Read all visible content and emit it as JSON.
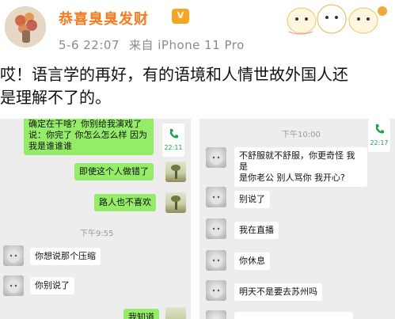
{
  "header": {
    "username": "恭喜臭臭发财",
    "vip_badge": "V",
    "date": "5-6 22:07",
    "source": "来自 iPhone 11 Pro"
  },
  "post": {
    "line1": "哎！语言学的再好，有的语境和人情世故外国人还",
    "line2": "是理解不了的。"
  },
  "left_chat": {
    "top_bubble": [
      "确定在干啥？你别给我演戏了",
      "说：你完了 你怎么怎么样 因为",
      "我是谁谁谁"
    ],
    "call_time": "22:11",
    "msg1": "即使这个人做错了",
    "msg2": "路人也不喜欢",
    "timestamp": "下午9:55",
    "msg3": "你想说那个压缩",
    "msg4": "你别说了",
    "msg5": "我知道"
  },
  "right_chat": {
    "timestamp": "下午10:00",
    "call_time": "22:17",
    "msg1": [
      "不舒服就不舒服，你更奇怪 我是",
      "是你老公 别人骂你 我开心?"
    ],
    "msg2": "别说了",
    "msg3": "我在直播",
    "msg4": "你休息",
    "msg5": "明天不是要去苏州吗"
  },
  "colors": {
    "username": "#f47b20",
    "green_bubble": "#95ec69",
    "chat_bg": "#ededed"
  }
}
